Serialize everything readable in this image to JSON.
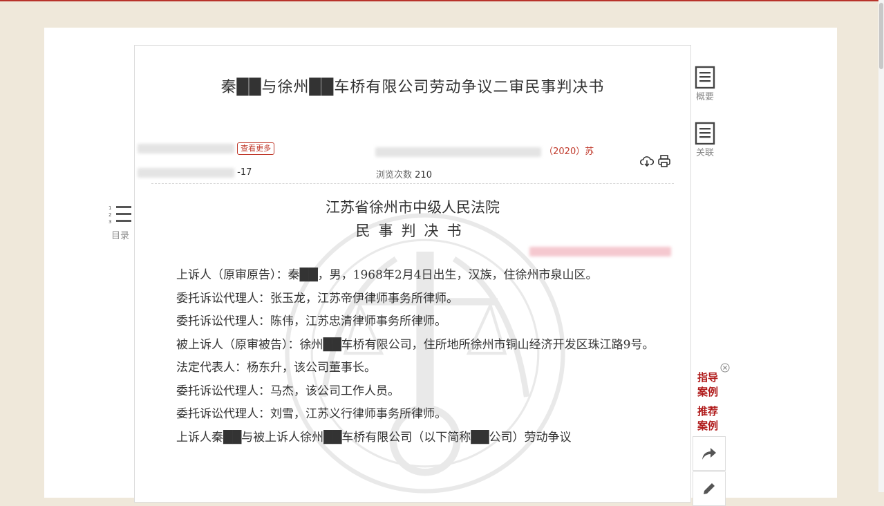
{
  "document": {
    "title": "秦██与徐州██车桥有限公司劳动争议二审民事判决书",
    "meta": {
      "view_more_tag": "查看更多",
      "date_fragment": "-17",
      "case_no_suffix": "（2020）苏",
      "views_label": "浏览次数",
      "views_count": "210"
    },
    "court_name": "江苏省徐州市中级人民法院",
    "doc_type": "民事判决书",
    "paragraphs": [
      "上诉人（原审原告）：秦██，男，1968年2月4日出生，汉族，住徐州市泉山区。",
      "委托诉讼代理人：张玉龙，江苏帝伊律师事务所律师。",
      "委托诉讼代理人：陈伟，江苏忠清律师事务所律师。",
      "被上诉人（原审被告）：徐州██车桥有限公司，住所地所徐州市铜山经济开发区珠江路9号。",
      "法定代表人：杨东升，该公司董事长。",
      "委托诉讼代理人：马杰，该公司工作人员。",
      "委托诉讼代理人：刘雪，江苏义行律师事务所律师。",
      "上诉人秦██与被上诉人徐州██车桥有限公司（以下简称██公司）劳动争议"
    ]
  },
  "sidebar_right": {
    "summary_label": "概要",
    "related_label": "关联",
    "guide_cases_label": "指导案例",
    "recommended_cases_label": "推荐案例",
    "share_icon": "share-icon",
    "edit_icon": "edit-icon"
  },
  "sidebar_left": {
    "toc_label": "目录"
  },
  "toolbar": {
    "download_icon": "cloud-download-icon",
    "print_icon": "print-icon"
  },
  "colors": {
    "background": "#efe8da",
    "accent_red": "#b01b1b"
  }
}
